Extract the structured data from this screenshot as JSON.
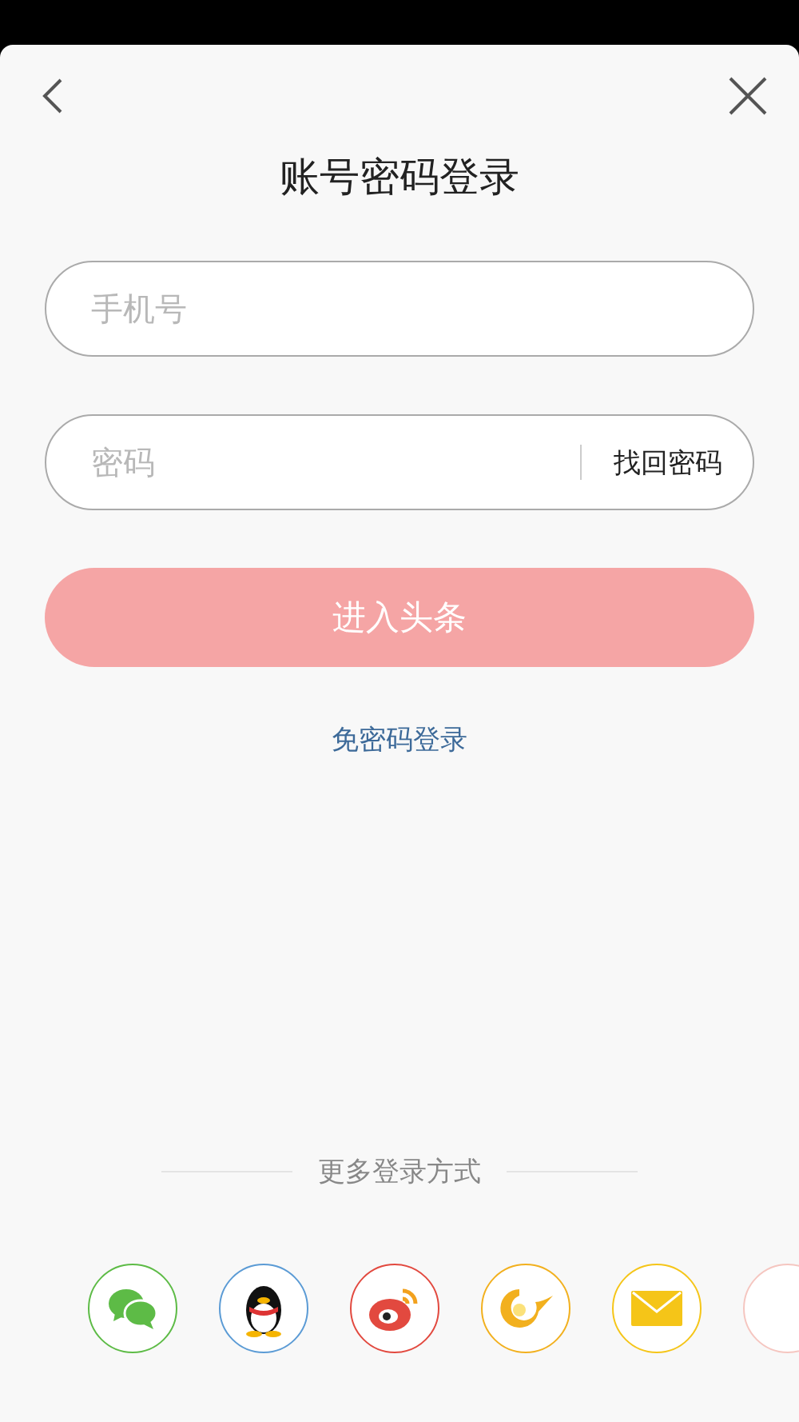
{
  "title": "账号密码登录",
  "phone_field": {
    "placeholder": "手机号"
  },
  "password_field": {
    "placeholder": "密码",
    "recover_link": "找回密码"
  },
  "submit_button": {
    "label": "进入头条",
    "disabled": true
  },
  "passwordless_link": "免密码登录",
  "more_methods": {
    "heading": "更多登录方式",
    "options": [
      {
        "kind": "chat",
        "color": "#5dbb46"
      },
      {
        "kind": "penguin",
        "color": "#5b9bd5"
      },
      {
        "kind": "eye",
        "color": "#e2493f"
      },
      {
        "kind": "swirl",
        "color": "#f2b01e"
      },
      {
        "kind": "envelope",
        "color": "#f5c518"
      },
      {
        "kind": "other",
        "color": "#f5c6c0"
      }
    ]
  }
}
